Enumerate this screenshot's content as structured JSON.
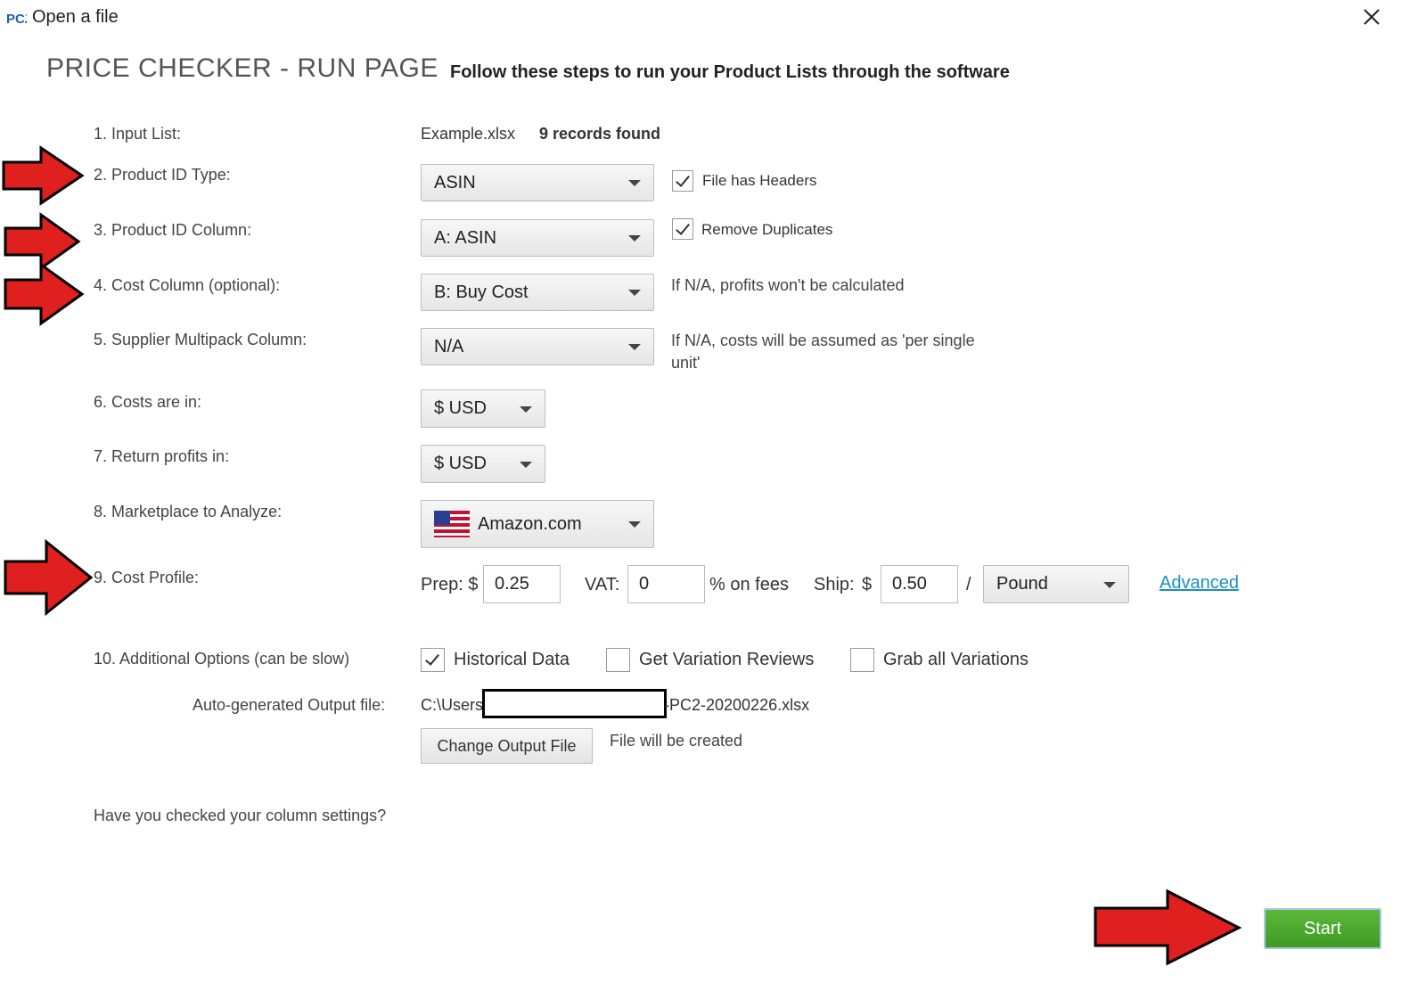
{
  "window": {
    "title": "Open a file",
    "app_icon_text": "PCZ",
    "accent_red": "#e01f1f",
    "start_green": "#4aa82c",
    "link_blue": "#1a8fc4"
  },
  "header": {
    "title": "PRICE CHECKER - RUN PAGE",
    "subtitle": "Follow these steps to run your Product Lists through the software"
  },
  "steps": {
    "input_list": {
      "label": "1. Input List:",
      "file": "Example.xlsx",
      "records": "9 records found"
    },
    "product_id_type": {
      "label": "2. Product ID Type:",
      "value": "ASIN",
      "checkbox_label": "File has Headers",
      "checked": true
    },
    "product_id_column": {
      "label": "3. Product ID Column:",
      "value": "A: ASIN",
      "checkbox_label": "Remove Duplicates",
      "checked": true
    },
    "cost_column": {
      "label": "4. Cost Column (optional):",
      "value": "B: Buy Cost",
      "hint": "If N/A, profits won't be calculated"
    },
    "multipack_column": {
      "label": "5. Supplier Multipack Column:",
      "value": "N/A",
      "hint_line1": "If N/A, costs will be assumed as 'per single",
      "hint_line2": "unit'"
    },
    "costs_in": {
      "label": "6. Costs are in:",
      "value": "$ USD"
    },
    "return_profits": {
      "label": "7. Return profits in:",
      "value": "$ USD"
    },
    "marketplace": {
      "label": "8. Marketplace to Analyze:",
      "value": "Amazon.com",
      "flag_icon": "us-flag-icon"
    },
    "cost_profile": {
      "label": "9. Cost Profile:",
      "prep_label": "Prep: $",
      "prep_value": "0.25",
      "vat_label": "VAT:",
      "vat_value": "0",
      "vat_suffix": "% on fees",
      "ship_label": "Ship:",
      "ship_currency": "$",
      "ship_value": "0.50",
      "ship_separator": "/",
      "ship_unit": "Pound",
      "advanced_link": "Advanced"
    },
    "additional_options": {
      "label": "10. Additional Options (can be slow)",
      "options": [
        {
          "label": "Historical Data",
          "checked": true
        },
        {
          "label": "Get Variation Reviews",
          "checked": false
        },
        {
          "label": "Grab all Variations",
          "checked": false
        }
      ]
    }
  },
  "output": {
    "label": "Auto-generated Output file:",
    "path_prefix": "C:\\Users",
    "path_suffix": "-PC2-20200226.xlsx",
    "change_button": "Change Output File",
    "status": "File will be created"
  },
  "footer": {
    "question": "Have you checked your column settings?",
    "start_button": "Start"
  }
}
